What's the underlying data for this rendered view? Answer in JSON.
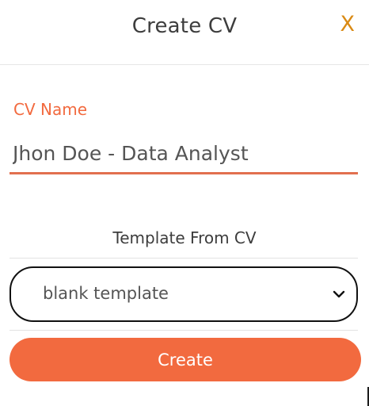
{
  "dialog": {
    "title": "Create CV",
    "close_label": "X"
  },
  "cv_name": {
    "label": "CV Name",
    "value": "Jhon Doe - Data Analyst"
  },
  "template": {
    "label": "Template From CV",
    "selected": "blank template"
  },
  "actions": {
    "create_label": "Create"
  },
  "colors": {
    "accent": "#f26a3f",
    "close": "#d98a14",
    "text": "#3d3d3d"
  },
  "icons": {
    "dropdown": "chevron-down-icon"
  }
}
